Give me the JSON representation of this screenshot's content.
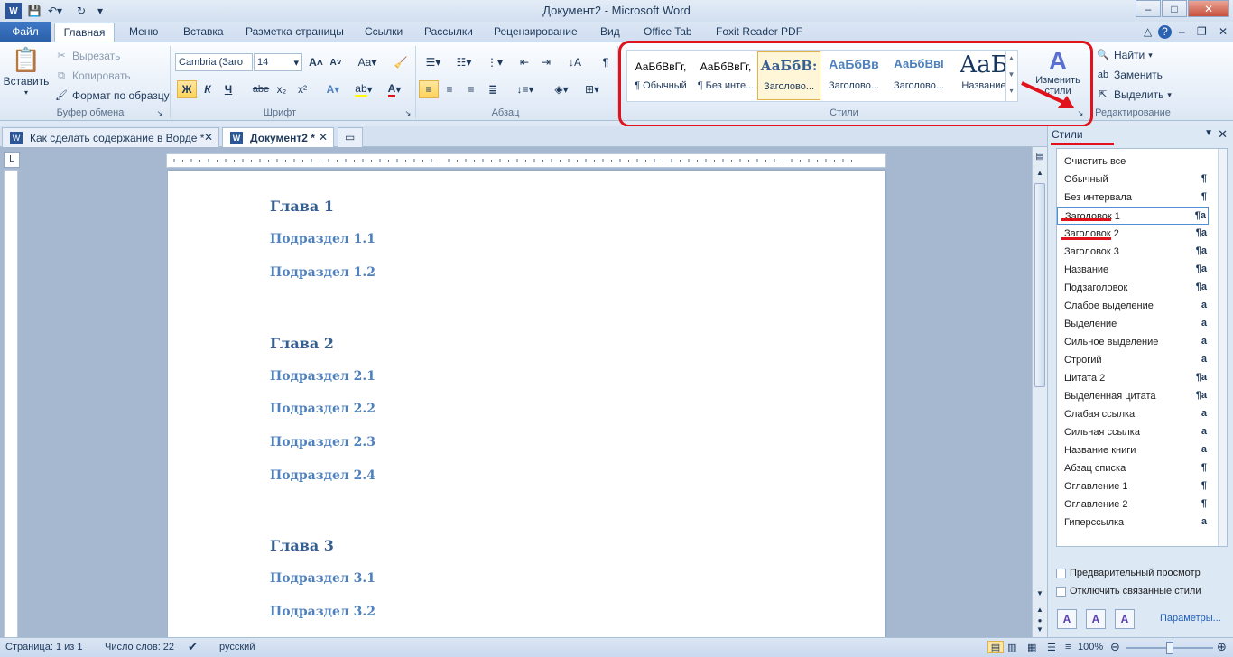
{
  "window": {
    "title": "Документ2 - Microsoft Word",
    "min": "–",
    "max": "□",
    "close": "✕"
  },
  "tabs": [
    {
      "label": "Файл"
    },
    {
      "label": "Главная"
    },
    {
      "label": "Меню"
    },
    {
      "label": "Вставка"
    },
    {
      "label": "Разметка страницы"
    },
    {
      "label": "Ссылки"
    },
    {
      "label": "Рассылки"
    },
    {
      "label": "Рецензирование"
    },
    {
      "label": "Вид"
    },
    {
      "label": "Office Tab"
    },
    {
      "label": "Foxit Reader PDF"
    }
  ],
  "ribbon": {
    "clipboard": {
      "paste": "Вставить",
      "cut": "Вырезать",
      "copy": "Копировать",
      "format_painter": "Формат по образцу",
      "label": "Буфер обмена"
    },
    "font": {
      "name": "Cambria (Заго",
      "size": "14",
      "bold": "Ж",
      "italic": "К",
      "underline": "Ч",
      "strike": "abe",
      "sub": "x₂",
      "sup": "x²",
      "label": "Шрифт",
      "grow": "A",
      "shrink": "A",
      "case": "Aa"
    },
    "paragraph": {
      "label": "Абзац"
    },
    "styles": {
      "label": "Стили",
      "change": "Изменить стили",
      "items": [
        {
          "preview": "АаБбВвГг,",
          "name": "¶ Обычный"
        },
        {
          "preview": "АаБбВвГг,",
          "name": "¶ Без инте..."
        },
        {
          "preview": "АаБбВ:",
          "name": "Заголово..."
        },
        {
          "preview": "АаБбВв",
          "name": "Заголово..."
        },
        {
          "preview": "АаБбВвI",
          "name": "Заголово..."
        },
        {
          "preview": "AaБ",
          "name": "Название"
        }
      ]
    },
    "editing": {
      "find": "Найти",
      "replace": "Заменить",
      "select": "Выделить",
      "label": "Редактирование"
    }
  },
  "doc_tabs": [
    {
      "label": "Как сделать содержание в Ворде *"
    },
    {
      "label": "Документ2 *"
    }
  ],
  "document": {
    "lines": [
      {
        "text": "Глава 1",
        "level": 1
      },
      {
        "text": "Подраздел 1.1",
        "level": 2
      },
      {
        "text": "Подраздел 1.2",
        "level": 2
      },
      {
        "text": "Глава 2",
        "level": 1
      },
      {
        "text": "Подраздел 2.1",
        "level": 2
      },
      {
        "text": "Подраздел 2.2",
        "level": 2
      },
      {
        "text": "Подраздел 2.3",
        "level": 2
      },
      {
        "text": "Подраздел 2.4",
        "level": 2
      },
      {
        "text": "Глава 3",
        "level": 1
      },
      {
        "text": "Подраздел 3.1",
        "level": 2
      },
      {
        "text": "Подраздел 3.2",
        "level": 2
      }
    ]
  },
  "styles_pane": {
    "title": "Стили",
    "items": [
      {
        "label": "Очистить все",
        "mark": ""
      },
      {
        "label": "Обычный",
        "mark": "¶"
      },
      {
        "label": "Без интервала",
        "mark": "¶"
      },
      {
        "label": "Заголовок 1",
        "mark": "¶a"
      },
      {
        "label": "Заголовок 2",
        "mark": "¶a"
      },
      {
        "label": "Заголовок 3",
        "mark": "¶a"
      },
      {
        "label": "Название",
        "mark": "¶a"
      },
      {
        "label": "Подзаголовок",
        "mark": "¶a"
      },
      {
        "label": "Слабое выделение",
        "mark": "a"
      },
      {
        "label": "Выделение",
        "mark": "a"
      },
      {
        "label": "Сильное выделение",
        "mark": "a"
      },
      {
        "label": "Строгий",
        "mark": "a"
      },
      {
        "label": "Цитата 2",
        "mark": "¶a"
      },
      {
        "label": "Выделенная цитата",
        "mark": "¶a"
      },
      {
        "label": "Слабая ссылка",
        "mark": "a"
      },
      {
        "label": "Сильная ссылка",
        "mark": "a"
      },
      {
        "label": "Название книги",
        "mark": "a"
      },
      {
        "label": "Абзац списка",
        "mark": "¶"
      },
      {
        "label": "Оглавление 1",
        "mark": "¶"
      },
      {
        "label": "Оглавление 2",
        "mark": "¶"
      },
      {
        "label": "Гиперссылка",
        "mark": "a"
      }
    ],
    "preview": "Предварительный просмотр",
    "disable_linked": "Отключить связанные стили",
    "options": "Параметры..."
  },
  "status": {
    "page": "Страница: 1 из 1",
    "words": "Число слов: 22",
    "lang": "русский",
    "zoom": "100%"
  },
  "colors": {
    "accent": "#2b579a",
    "highlight": "#e0121c",
    "heading1": "#365f91",
    "heading2": "#4f81bd"
  }
}
